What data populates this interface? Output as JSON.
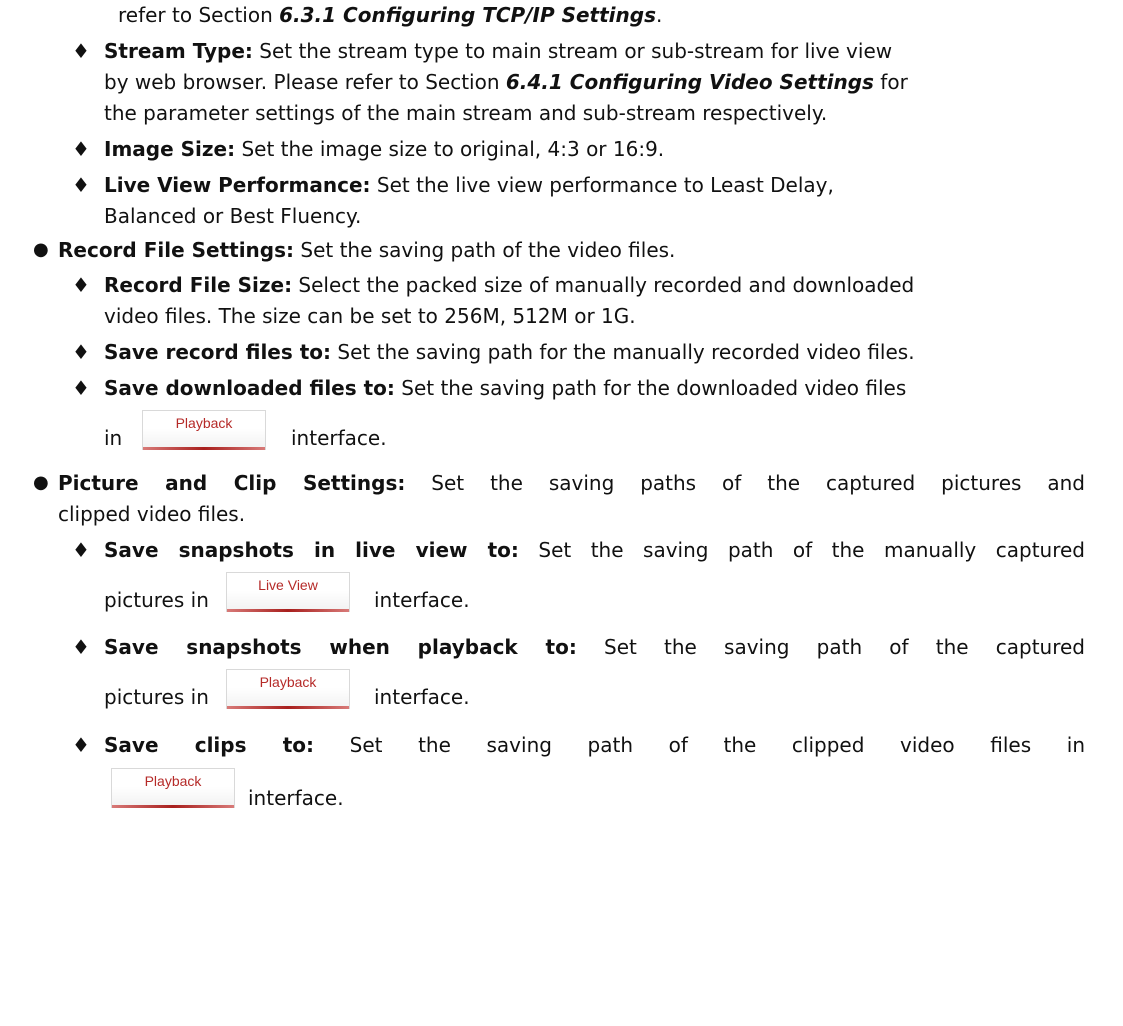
{
  "intro": {
    "prefix": "refer to Section ",
    "ref": "6.3.1 Configuring TCP/IP Settings",
    "suffix": "."
  },
  "live_view": {
    "stream_type": {
      "label": "Stream Type:",
      "text1": " Set the stream type to main stream or sub-stream for live view",
      "text2a": "by web browser. Please refer to Section ",
      "ref": "6.4.1 Configuring Video Settings",
      "text2b": " for",
      "text3": "the parameter settings of the main stream and sub-stream respectively."
    },
    "image_size": {
      "label": "Image Size:",
      "text": " Set the image size to original, 4:3 or 16:9."
    },
    "performance": {
      "label": "Live View Performance:",
      "text1": " Set the live view performance to Least Delay,",
      "text2": "Balanced or Best Fluency."
    }
  },
  "record_file_settings": {
    "label": "Record File Settings:",
    "text": " Set the saving path of the video files.",
    "record_file_size": {
      "label": "Record File Size:",
      "text1": " Select the packed size of manually recorded and downloaded",
      "text2": "video files. The size can be set to 256M, 512M or 1G."
    },
    "save_record": {
      "label": "Save record files to:",
      "text": " Set the saving path for the manually recorded video files."
    },
    "save_downloaded": {
      "label": "Save downloaded files to:",
      "text": " Set the saving path for the downloaded video files",
      "pre": "in",
      "button": "Playback",
      "post": "interface."
    }
  },
  "picture_clip_settings": {
    "label": "Picture and Clip Settings:",
    "text1": " Set the saving paths of the captured pictures and",
    "text2": "clipped video files.",
    "snap_live": {
      "label": "Save snapshots in live view to:",
      "text": " Set the saving path of the manually captured",
      "pre": "pictures in",
      "button": "Live View",
      "post": "interface."
    },
    "snap_playback": {
      "label": "Save snapshots when playback to:",
      "text": " Set the saving path of the captured",
      "pre": "pictures in",
      "button": "Playback",
      "post": "interface."
    },
    "save_clips": {
      "label": "Save clips to:",
      "text": " Set the saving path of the clipped video files in",
      "button": "Playback",
      "post": "interface."
    }
  },
  "glyphs": {
    "dot": "●",
    "diamond": "♦"
  },
  "colors": {
    "button_text": "#b52a28",
    "button_underline": "#a81f1d"
  }
}
